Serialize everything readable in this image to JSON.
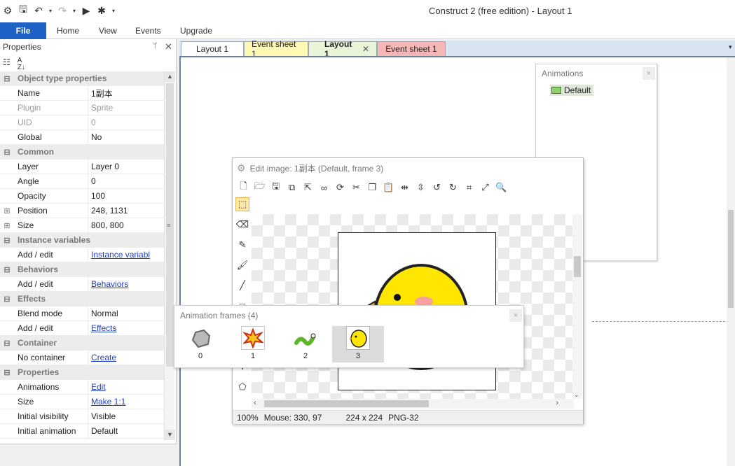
{
  "window": {
    "title": "Construct 2  (free edition) - Layout 1"
  },
  "qat": {
    "items": [
      "app-menu",
      "save",
      "undo",
      "redo",
      "run",
      "debug",
      "customize"
    ]
  },
  "ribbon": {
    "file_label": "File",
    "tabs": [
      "Home",
      "View",
      "Events",
      "Upgrade"
    ]
  },
  "properties_panel": {
    "title": "Properties",
    "pin": "ᛘ",
    "close": "✕",
    "rows": [
      {
        "type": "cat",
        "label": "Object type properties",
        "expander": "⊟"
      },
      {
        "type": "prop",
        "key": "Name",
        "value": "1副本"
      },
      {
        "type": "prop",
        "key": "Plugin",
        "value": "Sprite",
        "dim": true
      },
      {
        "type": "prop",
        "key": "UID",
        "value": "0",
        "dim": true
      },
      {
        "type": "prop",
        "key": "Global",
        "value": "No"
      },
      {
        "type": "cat",
        "label": "Common",
        "expander": "⊟"
      },
      {
        "type": "prop",
        "key": "Layer",
        "value": "Layer 0"
      },
      {
        "type": "prop",
        "key": "Angle",
        "value": "0"
      },
      {
        "type": "prop",
        "key": "Opacity",
        "value": "100"
      },
      {
        "type": "prop",
        "key": "Position",
        "value": "248, 1131",
        "expander": "⊞"
      },
      {
        "type": "prop",
        "key": "Size",
        "value": "800, 800",
        "expander": "⊞"
      },
      {
        "type": "cat",
        "label": "Instance variables",
        "expander": "⊟"
      },
      {
        "type": "prop",
        "key": "Add / edit",
        "value": "Instance variabl",
        "link": true
      },
      {
        "type": "cat",
        "label": "Behaviors",
        "expander": "⊟"
      },
      {
        "type": "prop",
        "key": "Add / edit",
        "value": "Behaviors",
        "link": true
      },
      {
        "type": "cat",
        "label": "Effects",
        "expander": "⊟"
      },
      {
        "type": "prop",
        "key": "Blend mode",
        "value": "Normal"
      },
      {
        "type": "prop",
        "key": "Add / edit",
        "value": "Effects",
        "link": true
      },
      {
        "type": "cat",
        "label": "Container",
        "expander": "⊟"
      },
      {
        "type": "prop",
        "key": "No container",
        "value": "Create",
        "link": true
      },
      {
        "type": "cat",
        "label": "Properties",
        "expander": "⊟"
      },
      {
        "type": "prop",
        "key": "Animations",
        "value": "Edit",
        "link": true
      },
      {
        "type": "prop",
        "key": "Size",
        "value": "Make 1:1",
        "link": true
      },
      {
        "type": "prop",
        "key": "Initial visibility",
        "value": "Visible"
      },
      {
        "type": "prop",
        "key": "Initial animation",
        "value": "Default"
      }
    ]
  },
  "doc_tabs": [
    {
      "label": "Layout 1",
      "color": "#ffffff"
    },
    {
      "label": "Event sheet 1",
      "color": "#fff9b3"
    },
    {
      "label": "Layout 1",
      "color": "#e9f4d8",
      "active": true,
      "close": "✕"
    },
    {
      "label": "Event sheet 1",
      "color": "#f8b7b7"
    }
  ],
  "animations_panel": {
    "title": "Animations",
    "close": "×",
    "item": "Default"
  },
  "edit_image": {
    "title": "Edit image: 1副本 (Default, frame 3)",
    "status": {
      "zoom": "100%",
      "mouse": "Mouse: 330, 97",
      "size": "224 x 224",
      "format": "PNG-32"
    }
  },
  "frames_panel": {
    "title": "Animation frames (4)",
    "close": "×",
    "frames": [
      {
        "label": "0",
        "icon": "rock-icon"
      },
      {
        "label": "1",
        "icon": "explosion-icon"
      },
      {
        "label": "2",
        "icon": "worm-icon"
      },
      {
        "label": "3",
        "icon": "chick-icon",
        "selected": true
      }
    ]
  },
  "colors": {
    "file_button": "#1f62c6",
    "link": "#1f3fbf",
    "chick_yellow": "#ffe600"
  }
}
